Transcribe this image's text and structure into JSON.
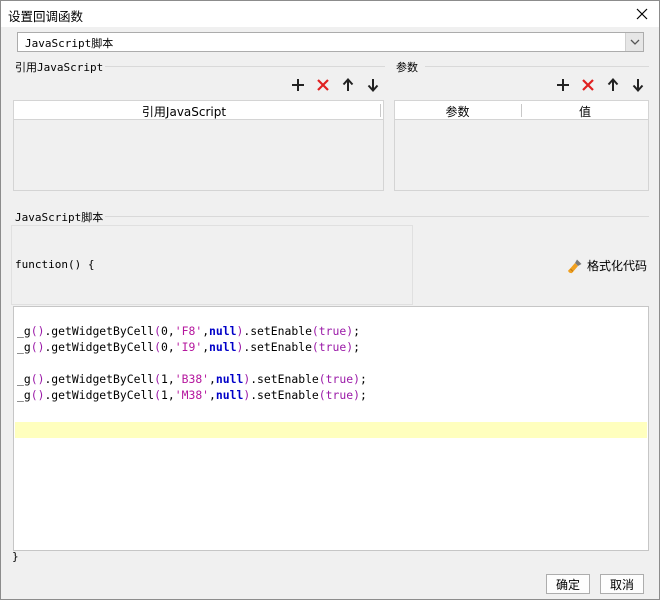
{
  "window": {
    "title": "设置回调函数"
  },
  "select": {
    "value": "JavaScript脚本"
  },
  "sections": {
    "ref_js": "引用JavaScript",
    "params": "参数",
    "script": "JavaScript脚本"
  },
  "ref_table": {
    "header": "引用JavaScript"
  },
  "param_table": {
    "col1": "参数",
    "col2": "值"
  },
  "script": {
    "function_header": "function() {",
    "format_label": "格式化代码",
    "close_brace": "}",
    "lines": [
      [
        "_g",
        "(",
        ")",
        ".getWidgetByCell",
        "(",
        "0",
        ",",
        "'F8'",
        ",",
        "null",
        ")",
        ".setEnable",
        "(",
        "true",
        ")",
        ";"
      ],
      [
        "_g",
        "(",
        ")",
        ".getWidgetByCell",
        "(",
        "0",
        ",",
        "'I9'",
        ",",
        "null",
        ")",
        ".setEnable",
        "(",
        "true",
        ")",
        ";"
      ],
      [
        "_g",
        "(",
        ")",
        ".getWidgetByCell",
        "(",
        "1",
        ",",
        "'B38'",
        ",",
        "null",
        ")",
        ".setEnable",
        "(",
        "true",
        ")",
        ";"
      ],
      [
        "_g",
        "(",
        ")",
        ".getWidgetByCell",
        "(",
        "1",
        ",",
        "'M38'",
        ",",
        "null",
        ")",
        ".setEnable",
        "(",
        "true",
        ")",
        ";"
      ]
    ]
  },
  "buttons": {
    "ok": "确定",
    "cancel": "取消"
  },
  "colors": {
    "keyword": "#0000c8",
    "paren": "#9b1aa8",
    "string": "#b5179e",
    "delete": "#e02020",
    "highlight": "#ffffbe",
    "brush": "#f0a020"
  }
}
